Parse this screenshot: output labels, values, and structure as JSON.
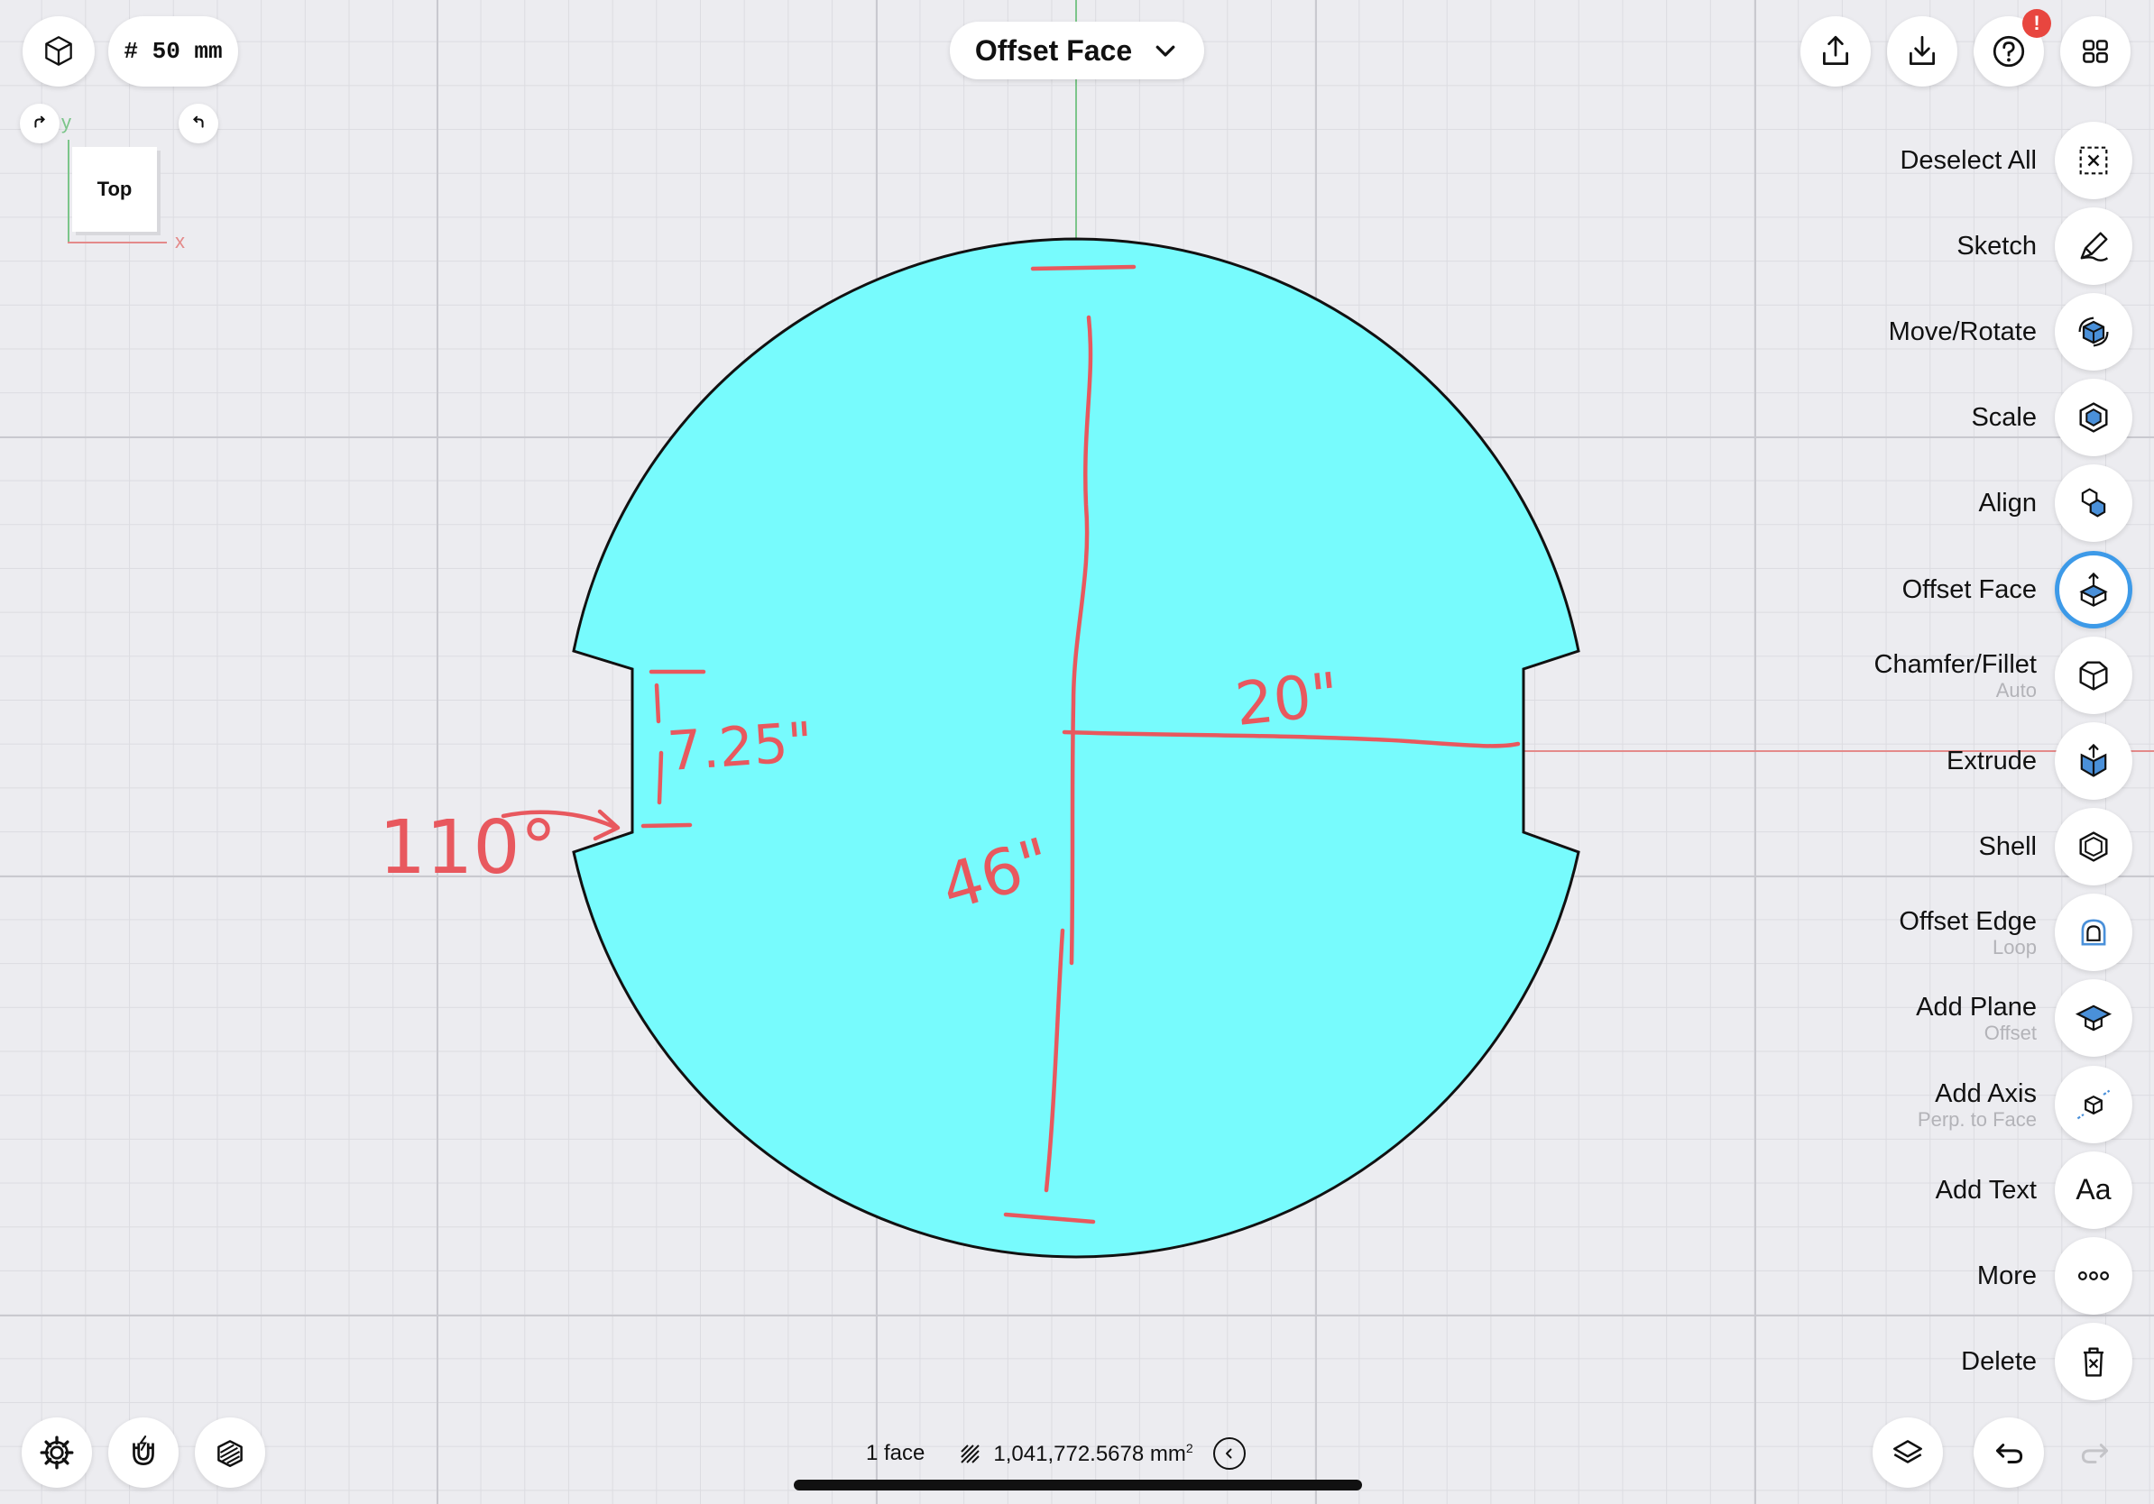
{
  "top_left": {
    "grid_size_label": "# 50 mm"
  },
  "view_cube": {
    "face_label": "Top",
    "axis_y": "y",
    "axis_x": "x"
  },
  "mode_menu": {
    "title": "Offset Face"
  },
  "top_right": {
    "help_badge": "!"
  },
  "tools": [
    {
      "label": "Deselect All",
      "sub": "",
      "icon": "deselect-icon"
    },
    {
      "label": "Sketch",
      "sub": "",
      "icon": "sketch-icon"
    },
    {
      "label": "Move/Rotate",
      "sub": "",
      "icon": "move-rotate-icon"
    },
    {
      "label": "Scale",
      "sub": "",
      "icon": "scale-icon"
    },
    {
      "label": "Align",
      "sub": "",
      "icon": "align-icon"
    },
    {
      "label": "Offset Face",
      "sub": "",
      "icon": "offset-face-icon",
      "active": true
    },
    {
      "label": "Chamfer/Fillet",
      "sub": "Auto",
      "icon": "chamfer-icon"
    },
    {
      "label": "Extrude",
      "sub": "",
      "icon": "extrude-icon"
    },
    {
      "label": "Shell",
      "sub": "",
      "icon": "shell-icon"
    },
    {
      "label": "Offset Edge",
      "sub": "Loop",
      "icon": "offset-edge-icon"
    },
    {
      "label": "Add Plane",
      "sub": "Offset",
      "icon": "add-plane-icon"
    },
    {
      "label": "Add Axis",
      "sub": "Perp. to Face",
      "icon": "add-axis-icon"
    },
    {
      "label": "Add Text",
      "sub": "",
      "icon": "add-text-icon",
      "glyph": "Aa"
    },
    {
      "label": "More",
      "sub": "",
      "icon": "more-icon"
    },
    {
      "label": "Delete",
      "sub": "",
      "icon": "delete-icon"
    }
  ],
  "status": {
    "selection": "1 face",
    "area_value": "1,041,772.5678 mm",
    "area_unit_sup": "2"
  },
  "annotations": {
    "diameter": "46\"",
    "radius": "20\"",
    "notch_width": "7.25\"",
    "angle": "110°"
  },
  "colors": {
    "face_fill": "#77fbfd",
    "accent": "#3d9ae8",
    "annotation": "#e8585e",
    "badge": "#e8463f"
  }
}
